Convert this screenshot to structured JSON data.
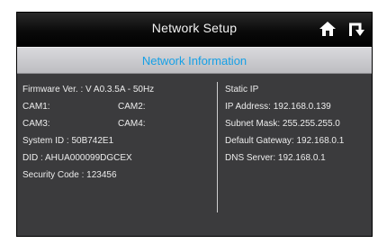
{
  "titlebar": {
    "title": "Network Setup",
    "home_icon": "home-icon",
    "back_icon": "return-icon"
  },
  "header": {
    "subtitle": "Network Information"
  },
  "device_info": {
    "firmware": "Firmware Ver. : V A0.3.5A - 50Hz",
    "cam1": "CAM1:",
    "cam2": "CAM2:",
    "cam3": "CAM3:",
    "cam4": "CAM4:",
    "system_id": "System ID : 50B742E1",
    "did": "DID : AHUA000099DGCEX",
    "security_code": "Security Code : 123456"
  },
  "network_info": {
    "mode": "Static IP",
    "ip_address": "IP Address: 192.168.0.139",
    "subnet_mask": "Subnet Mask: 255.255.255.0",
    "default_gateway": "Default Gateway: 192.168.0.1",
    "dns_server": "DNS Server: 192.168.0.1"
  },
  "colors": {
    "accent": "#16a0e6",
    "panel": "#3b3b3d",
    "titlebar": "#000000",
    "text": "#ececec"
  }
}
